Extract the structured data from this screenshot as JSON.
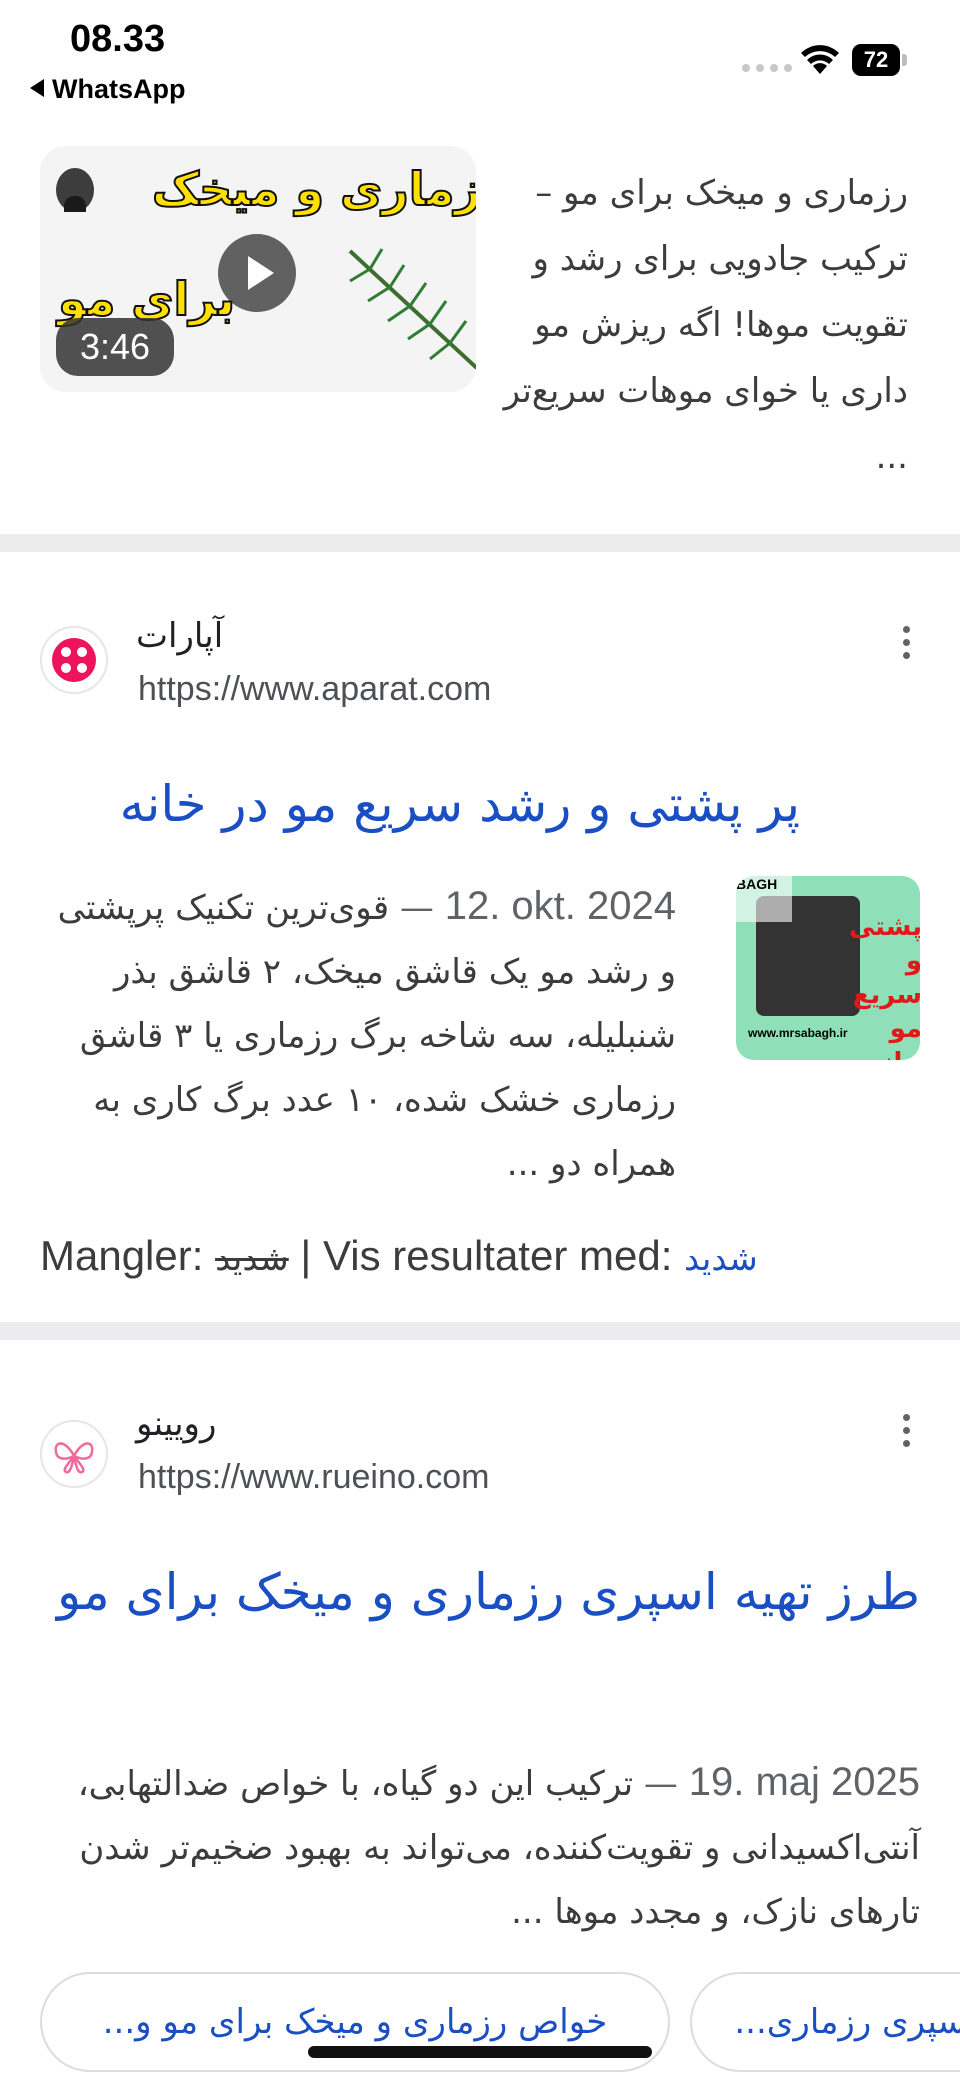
{
  "status_bar": {
    "time": "08.33",
    "back_app": "WhatsApp",
    "battery": "72"
  },
  "video": {
    "snippet": "رزماری و میخک برای مو – ترکیب جادویی برای رشد و تقویت موها! اگه ریزش مو داری یا خوای موهات سریع‌تر ...",
    "duration": "3:46",
    "thumb_line1": "رزماری و میخک",
    "thumb_line2": "برای مو"
  },
  "results": [
    {
      "site_name": "آپارات",
      "url": "https://www.aparat.com",
      "title": "پر پشتی و رشد سریع مو در خانه",
      "date": "12. okt. 2024",
      "dash": "—",
      "snippet": "قوی‌ترین تکنیک پرپشتی و رشد مو یک قاشق میخک، ۲ قاشق بذر شنبلیله، سه شاخه برگ رزماری یا ۳ قاشق رزماری خشک شده، ۱۰ عدد برگ کاری به همراه دو ...",
      "missing_label": "Mangler:",
      "missing_word": "شدید",
      "show_results_label": "| Vis resultater med:",
      "show_results_link": "شدید",
      "thumb_brand": "BAGH",
      "thumb_red_text": "پشتی و سریع مو خانه",
      "thumb_footer": "www.mrsabagh.ir"
    },
    {
      "site_name": "رویینو",
      "url": "https://www.rueino.com",
      "title": "طرز تهیه اسپری رزماری و میخک برای مو",
      "date": "19. maj 2025",
      "dash": "—",
      "snippet": "ترکیب این دو گیاه، با خواص ضدالتهابی، آنتی‌اکسیدانی و تقویت‌کننده، می‌تواند به بهبود ضخیم‌تر شدن تارهای نازک، و مجدد موها ..."
    }
  ],
  "chips": [
    "خواص رزماری و میخک برای مو و...",
    "اسپری رزماری..."
  ],
  "colors": {
    "link_blue": "#1a4fc4",
    "separator": "#ececee"
  }
}
